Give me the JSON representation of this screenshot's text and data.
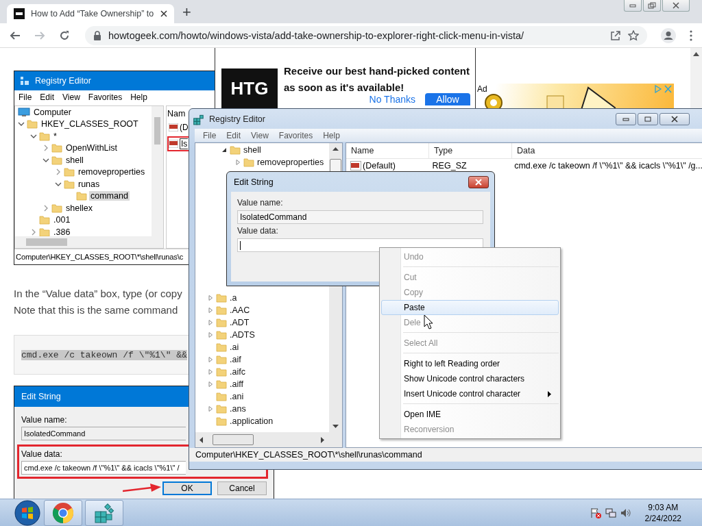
{
  "browser": {
    "tab_title": "How to Add “Take Ownership” to",
    "new_tab": "+",
    "url": "howtogeek.com/howto/windows-vista/add-take-ownership-to-explorer-right-click-menu-in-vista/"
  },
  "article": {
    "figure_1": {
      "title": "Registry Editor",
      "menu": [
        "File",
        "Edit",
        "View",
        "Favorites",
        "Help"
      ],
      "tree": [
        {
          "label": "Computer",
          "kind": "computer",
          "selected": false,
          "children": [
            {
              "label": "HKEY_CLASSES_ROOT",
              "kind": "folder",
              "expanded": true,
              "selected": false,
              "children": [
                {
                  "label": "*",
                  "kind": "folder",
                  "expanded": true,
                  "selected": false,
                  "children": [
                    {
                      "label": "OpenWithList",
                      "kind": "folder",
                      "expanded": false,
                      "selected": false
                    },
                    {
                      "label": "shell",
                      "kind": "folder",
                      "expanded": true,
                      "selected": false,
                      "children": [
                        {
                          "label": "removeproperties",
                          "kind": "folder",
                          "expanded": false,
                          "selected": false
                        },
                        {
                          "label": "runas",
                          "kind": "folder",
                          "expanded": true,
                          "selected": false,
                          "children": [
                            {
                              "label": "command",
                              "kind": "folder",
                              "selected": true
                            }
                          ]
                        }
                      ]
                    },
                    {
                      "label": "shellex",
                      "kind": "folder",
                      "expanded": false,
                      "selected": false
                    }
                  ]
                },
                {
                  "label": ".001",
                  "kind": "folder",
                  "selected": false
                },
                {
                  "label": ".386",
                  "kind": "folder",
                  "expanded": false,
                  "selected": false
                }
              ]
            }
          ]
        }
      ],
      "list_header": "Nam",
      "rows": [
        {
          "name": "(D",
          "annotated": false
        },
        {
          "name": "Is",
          "annotated": true
        }
      ],
      "status": "Computer\\HKEY_CLASSES_ROOT\\*\\shell\\runas\\c"
    },
    "paragraph": [
      "In the “Value data” box, type (or copy",
      "Note that this is the same command"
    ],
    "code": "cmd.exe /c takeown /f \\\"%1\\\" &&",
    "figure_2": {
      "title": "Edit String",
      "value_name_label": "Value name:",
      "value_name": "IsolatedCommand",
      "value_data_label": "Value data:",
      "value_data": "cmd.exe /c takeown /f \\\"%1\\\" && icacls \\\"%1\\\" /",
      "value_data_annotated": true,
      "buttons": [
        {
          "label": "OK",
          "selected": true,
          "annotated": true
        },
        {
          "label": "Cancel",
          "selected": false,
          "annotated": false
        }
      ]
    }
  },
  "notification": {
    "logo": "HTG",
    "message": "Receive our best hand-picked content as soon as it's available!",
    "dismiss": "No Thanks",
    "accept": "Allow"
  },
  "ad": {
    "label": "Ad"
  },
  "regedit": {
    "title": "Registry Editor",
    "menu": [
      "File",
      "Edit",
      "View",
      "Favorites",
      "Help"
    ],
    "tree_upper": [
      {
        "label": "shell",
        "expanded": true,
        "children": [
          {
            "label": "removeproperties",
            "expanded": false
          }
        ]
      }
    ],
    "tree_lower": [
      {
        "label": ".a",
        "expanded": false
      },
      {
        "label": ".AAC",
        "expanded": false
      },
      {
        "label": ".ADT",
        "expanded": false
      },
      {
        "label": ".ADTS",
        "expanded": false
      },
      {
        "label": ".ai"
      },
      {
        "label": ".aif",
        "expanded": false
      },
      {
        "label": ".aifc",
        "expanded": false
      },
      {
        "label": ".aiff",
        "expanded": false
      },
      {
        "label": ".ani"
      },
      {
        "label": ".ans",
        "expanded": false
      },
      {
        "label": ".application"
      }
    ],
    "columns": [
      "Name",
      "Type",
      "Data"
    ],
    "rows": [
      {
        "name": "(Default)",
        "type": "REG_SZ",
        "data": "cmd.exe /c takeown /f \\\"%1\\\" && icacls \\\"%1\\\" /g..."
      }
    ],
    "status": "Computer\\HKEY_CLASSES_ROOT\\*\\shell\\runas\\command"
  },
  "edit_dialog": {
    "title": "Edit String",
    "value_name_label": "Value name:",
    "value_name": "IsolatedCommand",
    "value_data_label": "Value data:"
  },
  "context_menu": [
    {
      "kind": "item",
      "label": "Undo",
      "disabled": true,
      "selected": false
    },
    {
      "kind": "separator"
    },
    {
      "kind": "item",
      "label": "Cut",
      "disabled": true,
      "selected": false
    },
    {
      "kind": "item",
      "label": "Copy",
      "disabled": true,
      "selected": false
    },
    {
      "kind": "item",
      "label": "Paste",
      "disabled": false,
      "selected": true
    },
    {
      "kind": "item",
      "label": "Dele",
      "disabled": true,
      "selected": false
    },
    {
      "kind": "separator"
    },
    {
      "kind": "item",
      "label": "Select All",
      "disabled": true,
      "selected": false
    },
    {
      "kind": "separator"
    },
    {
      "kind": "item",
      "label": "Right to left Reading order",
      "disabled": false,
      "selected": false
    },
    {
      "kind": "item",
      "label": "Show Unicode control characters",
      "disabled": false,
      "selected": false
    },
    {
      "kind": "submenu",
      "label": "Insert Unicode control character",
      "disabled": false,
      "selected": false
    },
    {
      "kind": "separator"
    },
    {
      "kind": "item",
      "label": "Open IME",
      "disabled": false,
      "selected": false
    },
    {
      "kind": "item",
      "label": "Reconversion",
      "disabled": true,
      "selected": false
    }
  ],
  "taskbar": {
    "time": "9:03 AM",
    "date": "2/24/2022"
  }
}
